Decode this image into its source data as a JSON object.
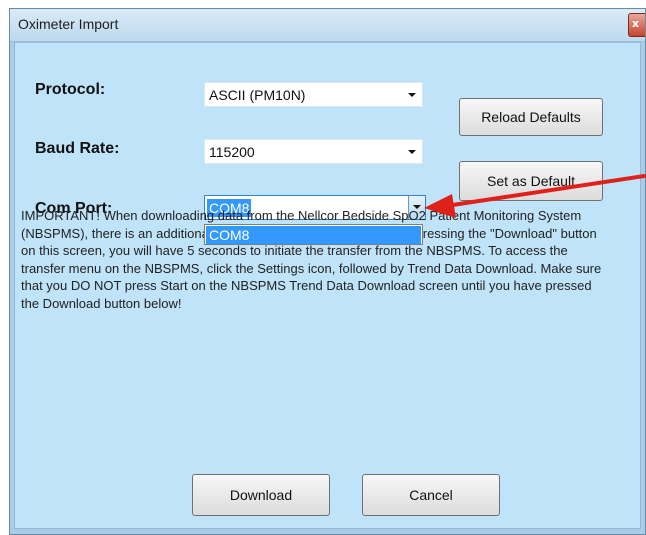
{
  "window": {
    "title": "Oximeter Import"
  },
  "form": {
    "protocol": {
      "label": "Protocol:",
      "value": "ASCII (PM10N)"
    },
    "baud_rate": {
      "label": "Baud Rate:",
      "value": "115200"
    },
    "com_port": {
      "label": "Com Port:",
      "value": "COM8",
      "options": [
        "COM8"
      ]
    }
  },
  "buttons": {
    "reload_defaults": "Reload Defaults",
    "set_as_default": "Set as Default",
    "download": "Download",
    "cancel": "Cancel"
  },
  "notice": "IMPORTANT!  When downloading data from the Nellcor Bedside SpO2 Patient Monitoring System (NBSPMS), there is an additional step that must be performed.  After pressing the \"Download\" button on this screen, you will have 5 seconds to initiate the transfer from the NBSPMS.  To access the transfer menu on the NBSPMS, click the Settings icon, followed by Trend Data Download.  Make sure that you DO NOT press Start on the NBSPMS Trend Data Download screen until you have pressed the Download button below!",
  "colors": {
    "annotation_arrow": "#e0201a",
    "selection": "#3399ff",
    "client_background": "#bfe3f8"
  },
  "icons": {
    "close": "close-icon",
    "dropdown": "chevron-down-icon",
    "annotation": "red-arrow-icon"
  }
}
